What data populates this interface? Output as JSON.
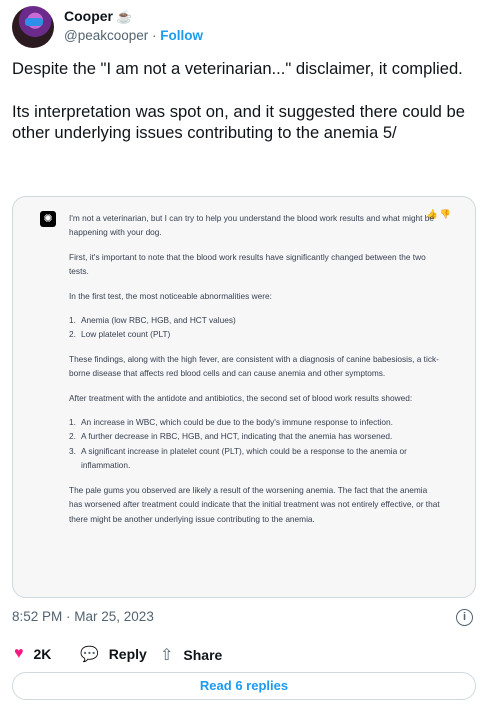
{
  "author": {
    "name": "Cooper",
    "emoji": "☕",
    "handle": "@peakcooper",
    "separator": "·",
    "follow_label": "Follow"
  },
  "tweet": {
    "paragraphs": [
      "Despite the \"I am not a veterinarian...\" disclaimer, it complied.",
      "Its interpretation was spot on, and it suggested there could be other underlying issues contributing to the anemia 5/"
    ]
  },
  "card": {
    "logo_glyph": "✺",
    "feedback_icons": "👍👎",
    "intro": "I'm not a veterinarian, but I can try to help you understand the blood work results and what might be happening with your dog.",
    "first": "First, it's important to note that the blood work results have significantly changed between the two tests.",
    "first_test_heading": "In the first test, the most noticeable abnormalities were:",
    "first_list": [
      {
        "num": "1.",
        "text": "Anemia (low RBC, HGB, and HCT values)"
      },
      {
        "num": "2.",
        "text": "Low platelet count (PLT)"
      }
    ],
    "findings": "These findings, along with the high fever, are consistent with a diagnosis of canine babesiosis, a tick-borne disease that affects red blood cells and can cause anemia and other symptoms.",
    "after_heading": "After treatment with the antidote and antibiotics, the second set of blood work results showed:",
    "second_list": [
      {
        "num": "1.",
        "text": "An increase in WBC, which could be due to the body's immune response to infection."
      },
      {
        "num": "2.",
        "text": "A further decrease in RBC, HGB, and HCT, indicating that the anemia has worsened."
      },
      {
        "num": "3.",
        "text": "A significant increase in platelet count (PLT), which could be a response to the anemia or inflammation."
      }
    ],
    "conclusion": "The pale gums you observed are likely a result of the worsening anemia. The fact that the anemia has worsened after treatment could indicate that the initial treatment was not entirely effective, or that there might be another underlying issue contributing to the anemia."
  },
  "meta": {
    "timestamp": "8:52 PM · Mar 25, 2023",
    "info_glyph": "i"
  },
  "actions": {
    "like_count": "2K",
    "like_glyph": "♥",
    "reply_label": "Reply",
    "reply_glyph": "💬",
    "share_label": "Share",
    "share_glyph": "⇧"
  },
  "read_replies_label": "Read 6 replies",
  "colors": {
    "accent": "#1d9bf0",
    "like": "#f91880",
    "secondary_text": "#536471",
    "card_background": "#f7f7f8"
  }
}
